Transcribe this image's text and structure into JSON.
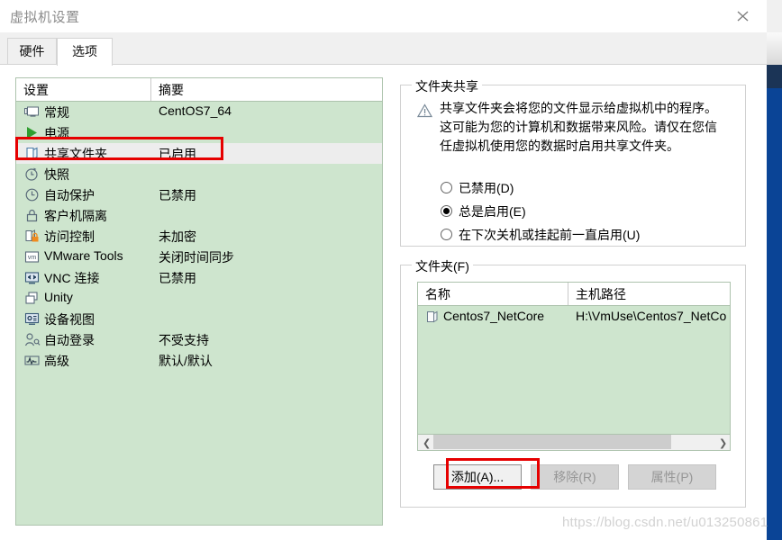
{
  "window": {
    "title": "虚拟机设置",
    "close_icon": "close-icon"
  },
  "tabs": [
    {
      "label": "硬件",
      "active": false
    },
    {
      "label": "选项",
      "active": true
    }
  ],
  "settings_list": {
    "columns": [
      "设置",
      "摘要"
    ],
    "rows": [
      {
        "icon": "monitor-icon",
        "name": "常规",
        "summary": "CentOS7_64",
        "selected": false
      },
      {
        "icon": "play-icon",
        "name": "电源",
        "summary": "",
        "selected": false
      },
      {
        "icon": "shared-folder-icon",
        "name": "共享文件夹",
        "summary": "已启用",
        "selected": true
      },
      {
        "icon": "snapshot-icon",
        "name": "快照",
        "summary": "",
        "selected": false
      },
      {
        "icon": "autoprotect-icon",
        "name": "自动保护",
        "summary": "已禁用",
        "selected": false
      },
      {
        "icon": "lock-icon",
        "name": "客户机隔离",
        "summary": "",
        "selected": false
      },
      {
        "icon": "access-control-icon",
        "name": "访问控制",
        "summary": "未加密",
        "selected": false
      },
      {
        "icon": "vmware-tools-icon",
        "name": "VMware Tools",
        "summary": "关闭时间同步",
        "selected": false
      },
      {
        "icon": "vnc-icon",
        "name": "VNC 连接",
        "summary": "已禁用",
        "selected": false
      },
      {
        "icon": "unity-icon",
        "name": "Unity",
        "summary": "",
        "selected": false
      },
      {
        "icon": "device-view-icon",
        "name": "设备视图",
        "summary": "",
        "selected": false
      },
      {
        "icon": "auto-login-icon",
        "name": "自动登录",
        "summary": "不受支持",
        "selected": false
      },
      {
        "icon": "advanced-icon",
        "name": "高级",
        "summary": "默认/默认",
        "selected": false
      }
    ]
  },
  "folder_sharing": {
    "legend": "文件夹共享",
    "warning_icon": "warning-icon",
    "warning_text": "共享文件夹会将您的文件显示给虚拟机中的程序。这可能为您的计算机和数据带来风险。请仅在您信任虚拟机使用您的数据时启用共享文件夹。",
    "options": [
      {
        "label": "已禁用(D)",
        "selected": false
      },
      {
        "label": "总是启用(E)",
        "selected": true
      },
      {
        "label": "在下次关机或挂起前一直启用(U)",
        "selected": false
      }
    ]
  },
  "folders": {
    "legend": "文件夹(F)",
    "columns": [
      "名称",
      "主机路径"
    ],
    "rows": [
      {
        "icon": "folder-icon",
        "name": "Centos7_NetCore",
        "host_path": "H:\\VmUse\\Centos7_NetCo"
      }
    ],
    "scrollbar": {
      "left_arrow": "chevron-left-icon",
      "right_arrow": "chevron-right-icon"
    },
    "buttons": [
      {
        "label": "添加(A)...",
        "enabled": true,
        "highlighted": true
      },
      {
        "label": "移除(R)",
        "enabled": false,
        "highlighted": false
      },
      {
        "label": "属性(P)",
        "enabled": false,
        "highlighted": false
      }
    ]
  },
  "watermark": "https://blog.csdn.net/u013250861",
  "colors": {
    "list_background": "#cee5ce",
    "selected_row": "#ededed",
    "highlight_box": "#e60000",
    "accent_blue": "#0a4496",
    "power_green": "#2f9e2f"
  }
}
